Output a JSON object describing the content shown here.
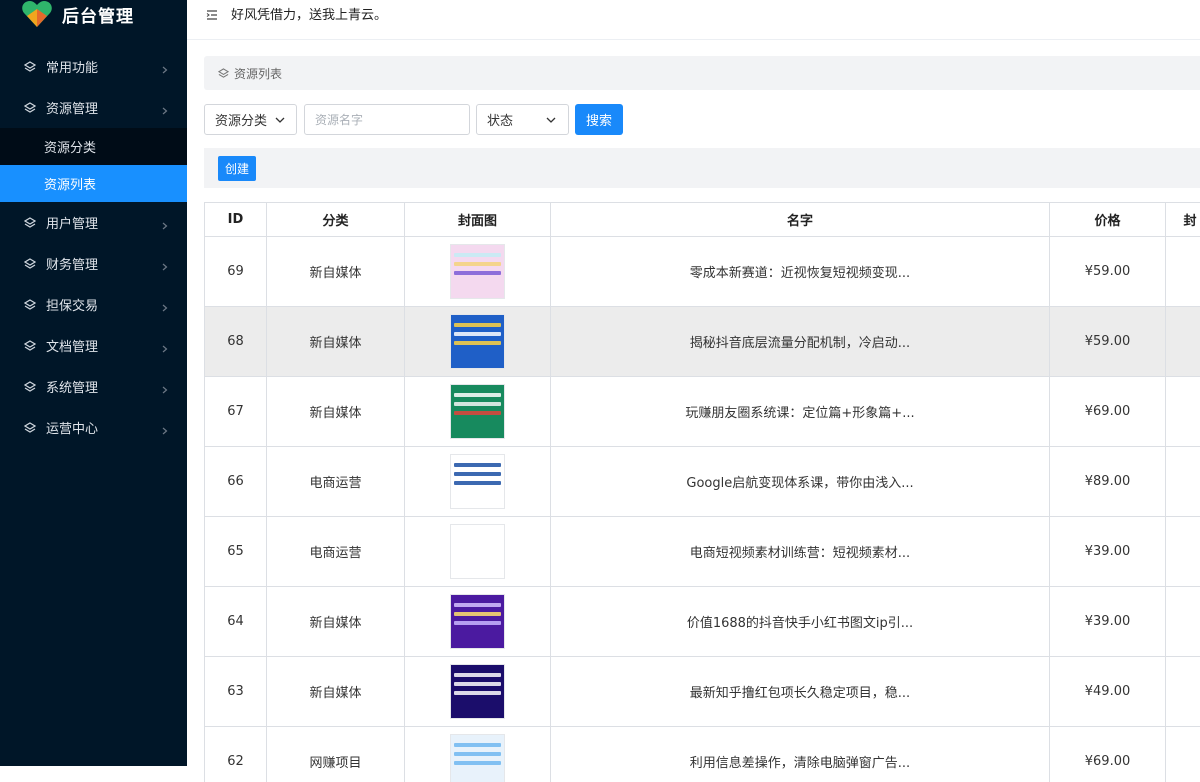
{
  "app": {
    "title": "后台管理",
    "motto": "好风凭借力，送我上青云。"
  },
  "sidebar": {
    "items": [
      {
        "label": "常用功能"
      },
      {
        "label": "资源管理"
      },
      {
        "label": "用户管理"
      },
      {
        "label": "财务管理"
      },
      {
        "label": "担保交易"
      },
      {
        "label": "文档管理"
      },
      {
        "label": "系统管理"
      },
      {
        "label": "运营中心"
      }
    ],
    "sub_items": [
      {
        "label": "资源分类"
      },
      {
        "label": "资源列表"
      }
    ]
  },
  "breadcrumb": {
    "label": "资源列表"
  },
  "filters": {
    "category_label": "资源分类",
    "name_placeholder": "资源名字",
    "status_label": "状态",
    "search_label": "搜索"
  },
  "toolbar": {
    "create_label": "创建"
  },
  "table": {
    "headers": {
      "id": "ID",
      "category": "分类",
      "cover": "封面图",
      "name": "名字",
      "price": "价格",
      "extra": "封"
    },
    "rows": [
      {
        "id": "69",
        "category": "新自媒体",
        "name": "零成本新赛道：近视恢复短视频变现...",
        "price": "¥59.00",
        "cover_color": "#f4d9ef"
      },
      {
        "id": "68",
        "category": "新自媒体",
        "name": "揭秘抖音底层流量分配机制，冷启动...",
        "price": "¥59.00",
        "cover_color": "#1f5fc7"
      },
      {
        "id": "67",
        "category": "新自媒体",
        "name": "玩赚朋友圈系统课：定位篇+形象篇+...",
        "price": "¥69.00",
        "cover_color": "#178a5e"
      },
      {
        "id": "66",
        "category": "电商运营",
        "name": "Google启航变现体系课，带你由浅入...",
        "price": "¥89.00",
        "cover_color": "#ffffff"
      },
      {
        "id": "65",
        "category": "电商运营",
        "name": "电商短视频素材训练营：短视频素材...",
        "price": "¥39.00",
        "cover_color": "#ffffff"
      },
      {
        "id": "64",
        "category": "新自媒体",
        "name": "价值1688的抖音快手小红书图文ip引...",
        "price": "¥39.00",
        "cover_color": "#4b1aa0"
      },
      {
        "id": "63",
        "category": "新自媒体",
        "name": "最新知乎撸红包项长久稳定项目，稳...",
        "price": "¥49.00",
        "cover_color": "#1b0d6b"
      },
      {
        "id": "62",
        "category": "网赚项目",
        "name": "利用信息差操作，清除电脑弹窗广告...",
        "price": "¥69.00",
        "cover_color": "#e8f2fb"
      }
    ]
  }
}
